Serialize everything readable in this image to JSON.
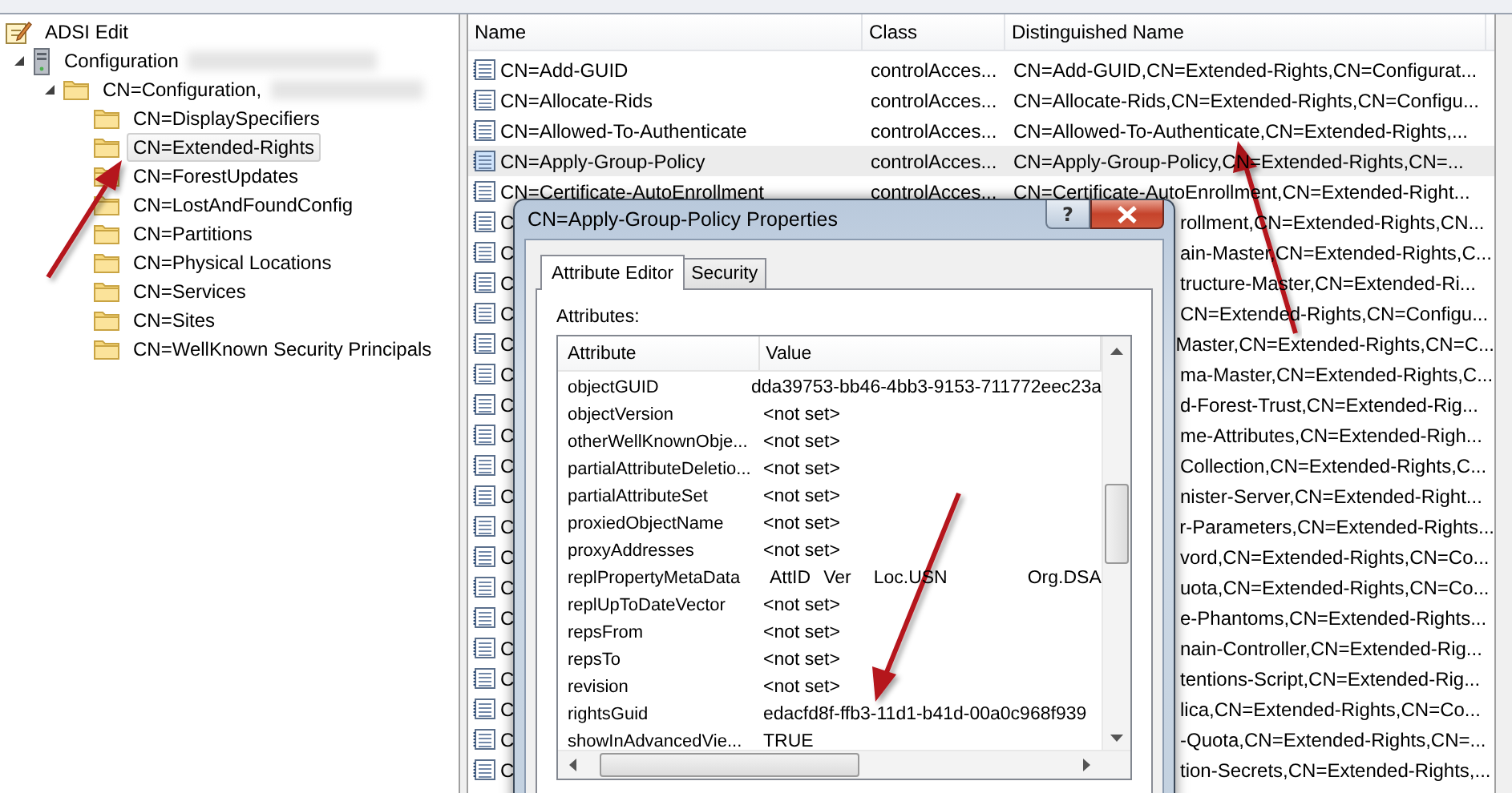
{
  "tree": {
    "label": "ADSI Edit",
    "children": [
      {
        "label": "Configuration",
        "expanded": true,
        "redacted": true,
        "children": [
          {
            "label": "CN=Configuration,",
            "expanded": true,
            "redacted": true,
            "children": [
              {
                "label": "CN=DisplaySpecifiers",
                "selected": false
              },
              {
                "label": "CN=Extended-Rights",
                "selected": true
              },
              {
                "label": "CN=ForestUpdates",
                "selected": false
              },
              {
                "label": "CN=LostAndFoundConfig",
                "selected": false
              },
              {
                "label": "CN=Partitions",
                "selected": false
              },
              {
                "label": "CN=Physical Locations",
                "selected": false
              },
              {
                "label": "CN=Services",
                "selected": false
              },
              {
                "label": "CN=Sites",
                "selected": false
              },
              {
                "label": "CN=WellKnown Security Principals",
                "selected": false
              }
            ]
          }
        ]
      }
    ]
  },
  "list": {
    "columns": [
      "Name",
      "Class",
      "Distinguished Name"
    ],
    "rows": [
      {
        "kind": "full",
        "name": "CN=Add-GUID",
        "class": "controlAcces...",
        "dn": "CN=Add-GUID,CN=Extended-Rights,CN=Configurat...",
        "selected": false
      },
      {
        "kind": "full",
        "name": "CN=Allocate-Rids",
        "class": "controlAcces...",
        "dn": "CN=Allocate-Rids,CN=Extended-Rights,CN=Configu...",
        "selected": false
      },
      {
        "kind": "full",
        "name": "CN=Allowed-To-Authenticate",
        "class": "controlAcces...",
        "dn": "CN=Allowed-To-Authenticate,CN=Extended-Rights,...",
        "selected": false
      },
      {
        "kind": "full",
        "name": "CN=Apply-Group-Policy",
        "class": "controlAcces...",
        "dn": "CN=Apply-Group-Policy,CN=Extended-Rights,CN=...",
        "selected": true
      },
      {
        "kind": "full",
        "name": "CN=Certificate-AutoEnrollment",
        "class": "controlAcces...",
        "dn": "CN=Certificate-AutoEnrollment,CN=Extended-Right...",
        "selected": false
      },
      {
        "kind": "partial",
        "name": "C",
        "dn": "rollment,CN=Extended-Rights,CN..."
      },
      {
        "kind": "partial",
        "name": "C",
        "dn": "ain-Master,CN=Extended-Rights,C..."
      },
      {
        "kind": "partial",
        "name": "C",
        "dn": "tructure-Master,CN=Extended-Ri..."
      },
      {
        "kind": "partial",
        "name": "C",
        "dn": "CN=Extended-Rights,CN=Configu..."
      },
      {
        "kind": "partial",
        "name": "C",
        "dn": "Master,CN=Extended-Rights,CN=C..."
      },
      {
        "kind": "partial",
        "name": "C",
        "dn": "ma-Master,CN=Extended-Rights,C..."
      },
      {
        "kind": "partial",
        "name": "C",
        "dn": "d-Forest-Trust,CN=Extended-Rig..."
      },
      {
        "kind": "partial",
        "name": "C",
        "dn": "me-Attributes,CN=Extended-Righ..."
      },
      {
        "kind": "partial",
        "name": "C",
        "dn": "Collection,CN=Extended-Rights,C..."
      },
      {
        "kind": "partial",
        "name": "C",
        "dn": "nister-Server,CN=Extended-Right..."
      },
      {
        "kind": "partial",
        "name": "C",
        "dn": "r-Parameters,CN=Extended-Rights..."
      },
      {
        "kind": "partial",
        "name": "C",
        "dn": "vord,CN=Extended-Rights,CN=Co..."
      },
      {
        "kind": "partial",
        "name": "C",
        "dn": "uota,CN=Extended-Rights,CN=Co..."
      },
      {
        "kind": "partial",
        "name": "C",
        "dn": "e-Phantoms,CN=Extended-Rights..."
      },
      {
        "kind": "partial",
        "name": "C",
        "dn": "nain-Controller,CN=Extended-Rig..."
      },
      {
        "kind": "partial",
        "name": "C",
        "dn": "tentions-Script,CN=Extended-Rig..."
      },
      {
        "kind": "partial",
        "name": "C",
        "dn": "lica,CN=Extended-Rights,CN=Co..."
      },
      {
        "kind": "partial",
        "name": "C",
        "dn": "-Quota,CN=Extended-Rights,CN=..."
      },
      {
        "kind": "partial",
        "name": "C",
        "dn": "tion-Secrets,CN=Extended-Rights,..."
      }
    ]
  },
  "dialog": {
    "title": "CN=Apply-Group-Policy Properties",
    "help": "?",
    "tabs": [
      {
        "label": "Attribute Editor",
        "selected": true
      },
      {
        "label": "Security",
        "selected": false
      }
    ],
    "attributes_label": "Attributes:",
    "columns": [
      "Attribute",
      "Value"
    ],
    "rows": [
      {
        "kind": "text",
        "attribute": "objectGUID",
        "value": "dda39753-bb46-4bb3-9153-711772eec23a"
      },
      {
        "kind": "text",
        "attribute": "objectVersion",
        "value": "<not set>"
      },
      {
        "kind": "text",
        "attribute": "otherWellKnownObje...",
        "value": "<not set>"
      },
      {
        "kind": "text",
        "attribute": "partialAttributeDeletio...",
        "value": "<not set>"
      },
      {
        "kind": "text",
        "attribute": "partialAttributeSet",
        "value": "<not set>"
      },
      {
        "kind": "text",
        "attribute": "proxiedObjectName",
        "value": "<not set>"
      },
      {
        "kind": "text",
        "attribute": "proxyAddresses",
        "value": "<not set>"
      },
      {
        "kind": "columns",
        "attribute": "replPropertyMetaData",
        "values": [
          "AttID",
          "Ver",
          "Loc.USN",
          "Org.DSA"
        ]
      },
      {
        "kind": "text",
        "attribute": "replUpToDateVector",
        "value": "<not set>"
      },
      {
        "kind": "text",
        "attribute": "repsFrom",
        "value": "<not set>"
      },
      {
        "kind": "text",
        "attribute": "repsTo",
        "value": "<not set>"
      },
      {
        "kind": "text",
        "attribute": "revision",
        "value": "<not set>"
      },
      {
        "kind": "text",
        "attribute": "rightsGuid",
        "value": "edacfd8f-ffb3-11d1-b41d-00a0c968f939"
      },
      {
        "kind": "text",
        "attribute": "showInAdvancedVie...",
        "value": "TRUE"
      }
    ]
  }
}
